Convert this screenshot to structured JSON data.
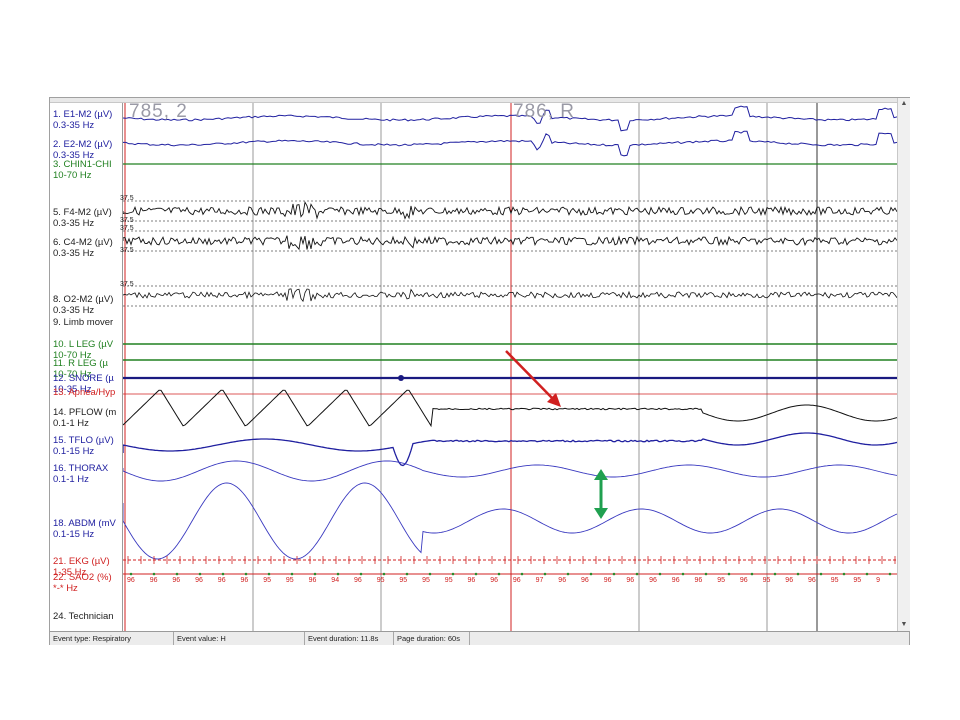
{
  "epochs": {
    "left": "785, 2",
    "right": "786, R"
  },
  "channels": [
    {
      "label": "1. E1-M2 (µV)",
      "sub": "0.3-35 Hz",
      "color": "#2020a0"
    },
    {
      "label": "2. E2-M2 (µV)",
      "sub": "0.3-35 Hz",
      "color": "#2020a0"
    },
    {
      "label": "3. CHIN1-CHI",
      "sub": "10-70 Hz",
      "color": "#208020"
    },
    {
      "label": "5. F4-M2 (µV)",
      "sub": "0.3-35 Hz",
      "color": "#222222"
    },
    {
      "label": "6. C4-M2 (µV)",
      "sub": "0.3-35 Hz",
      "color": "#222222"
    },
    {
      "label": "8. O2-M2 (µV)",
      "sub": "0.3-35 Hz",
      "color": "#222222"
    },
    {
      "label": "9. Limb mover",
      "sub": "",
      "color": "#222222"
    },
    {
      "label": "10. L LEG (µV",
      "sub": "10-70 Hz",
      "color": "#208020"
    },
    {
      "label": "11. R LEG (µ",
      "sub": "10-70 Hz",
      "color": "#208020"
    },
    {
      "label": "12. SNORE (µ",
      "sub": "10-35 Hz",
      "color": "#2020a0"
    },
    {
      "label": "13. Apnea/Hyp",
      "sub": "",
      "color": "#d02020"
    },
    {
      "label": "14. PFLOW (m",
      "sub": "0.1-1 Hz",
      "color": "#222222"
    },
    {
      "label": "15. TFLO (µV)",
      "sub": "0.1-15 Hz",
      "color": "#2020a0"
    },
    {
      "label": "16. THORAX",
      "sub": "0.1-1 Hz",
      "color": "#2020a0"
    },
    {
      "label": "18. ABDM (mV",
      "sub": "0.1-15 Hz",
      "color": "#2020a0"
    },
    {
      "label": "21. EKG (µV)",
      "sub": "1-35 Hz",
      "color": "#d02020"
    },
    {
      "label": "22. SAO2 (%)",
      "sub": "*-* Hz",
      "color": "#d02020"
    },
    {
      "label": "24. Technician",
      "sub": "",
      "color": "#222222"
    }
  ],
  "scale_value": "37.5",
  "sao2_values": [
    "96",
    "96",
    "96",
    "96",
    "96",
    "96",
    "95",
    "95",
    "96",
    "94",
    "96",
    "95",
    "95",
    "95",
    "95",
    "96",
    "96",
    "96",
    "97",
    "96",
    "96",
    "96",
    "96",
    "96",
    "96",
    "96",
    "95",
    "96",
    "95",
    "96",
    "96",
    "95",
    "95",
    "9"
  ],
  "status": {
    "event_type": "Event type: Respiratory",
    "event_value": "Event value: H",
    "event_duration": "Event duration: 11.8s",
    "page_duration": "Page duration: 60s"
  },
  "annotations": {
    "apnea_arrow_color": "#d02020",
    "effort_arrow_color": "#20a050"
  },
  "icons": [
    "scroll-up-icon",
    "scroll-down-icon",
    "red-arrow-icon",
    "green-double-arrow-icon"
  ]
}
